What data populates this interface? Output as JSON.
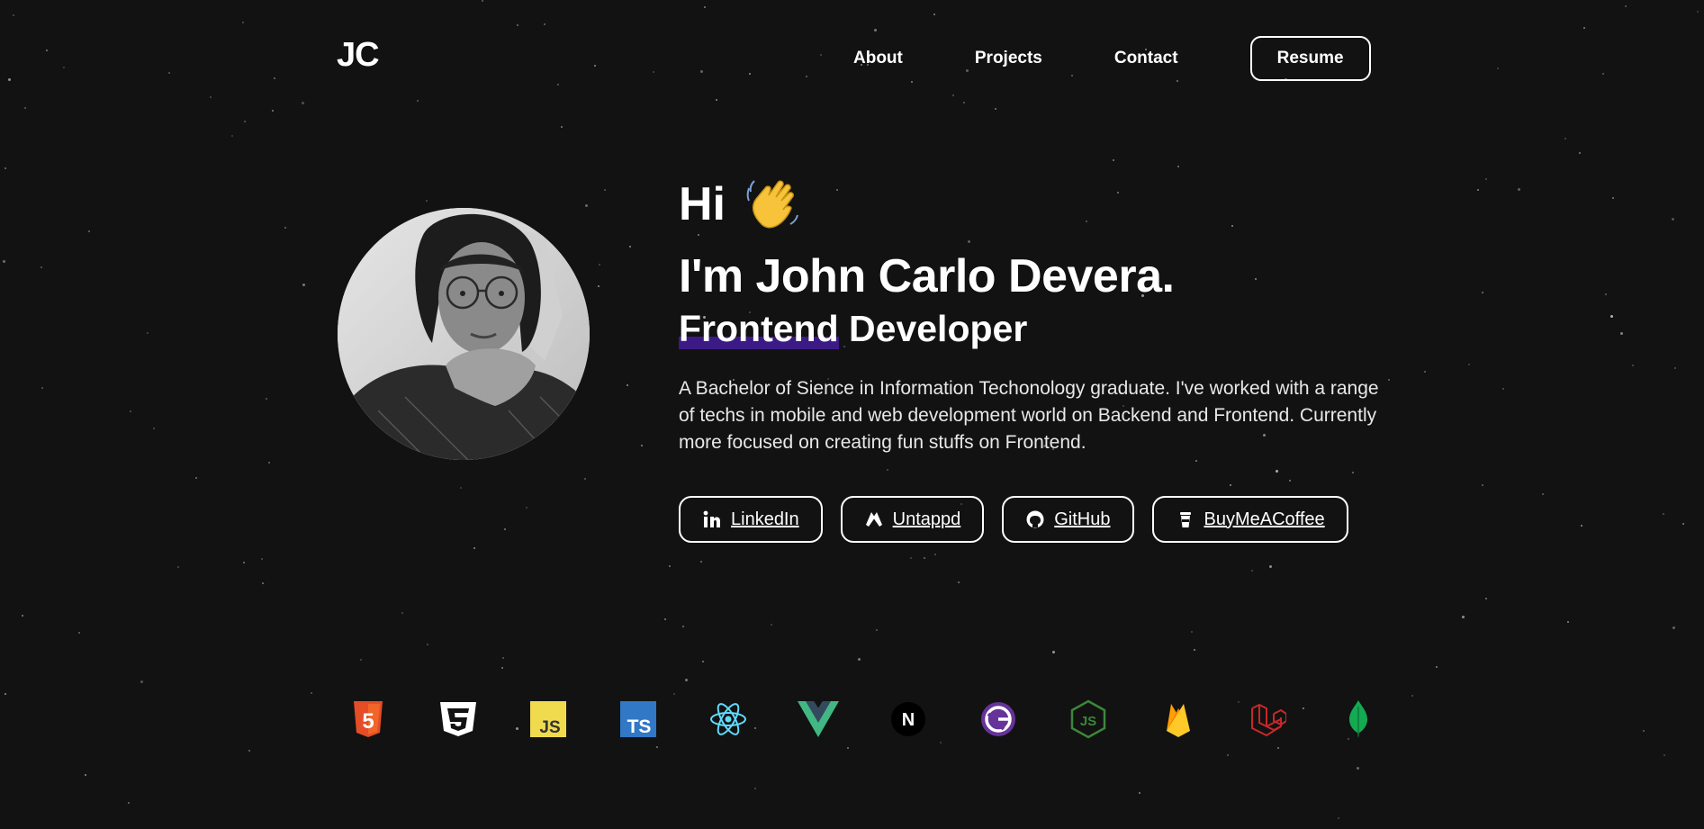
{
  "brand": {
    "logo": "JC"
  },
  "nav": {
    "items": [
      {
        "label": "About"
      },
      {
        "label": "Projects"
      },
      {
        "label": "Contact"
      }
    ],
    "resume_label": "Resume"
  },
  "hero": {
    "greeting": "Hi",
    "name": "I'm John Carlo Devera.",
    "role_highlight": "Frontend",
    "role_rest": " Developer",
    "description": "A Bachelor of Sience in Information Techonology graduate. I've worked with a range of techs in mobile and web development world on Backend and Frontend. Currently more focused on creating fun stuffs on Frontend."
  },
  "social": {
    "links": [
      {
        "label": "LinkedIn",
        "icon": "linkedin-icon"
      },
      {
        "label": "Untappd",
        "icon": "untappd-icon"
      },
      {
        "label": "GitHub",
        "icon": "github-icon"
      },
      {
        "label": "BuyMeACoffee",
        "icon": "coffee-cup-icon"
      }
    ]
  },
  "tech_stack": [
    {
      "icon": "html5-icon",
      "label": "5",
      "color": "#E44D26"
    },
    {
      "icon": "css3-icon",
      "label": "3",
      "color": "#FFFFFF"
    },
    {
      "icon": "javascript-icon",
      "label": "JS",
      "color": "#F0DB4F"
    },
    {
      "icon": "typescript-icon",
      "label": "TS",
      "color": "#3178C6"
    },
    {
      "icon": "react-icon",
      "color": "#61DAFB"
    },
    {
      "icon": "vue-icon",
      "color": "#41B883"
    },
    {
      "icon": "nextjs-icon",
      "label": "N",
      "color": "#000000"
    },
    {
      "icon": "gatsby-icon",
      "label": "G",
      "color": "#663399"
    },
    {
      "icon": "nodejs-icon",
      "label": "JS",
      "color": "#3C873A"
    },
    {
      "icon": "firebase-icon",
      "color": "#FFA000"
    },
    {
      "icon": "laravel-icon",
      "color": "#C62828"
    },
    {
      "icon": "mongodb-icon",
      "color": "#13AA52"
    }
  ],
  "colors": {
    "background": "#121212",
    "highlight": "#3B1A86",
    "text": "#FFFFFF"
  }
}
